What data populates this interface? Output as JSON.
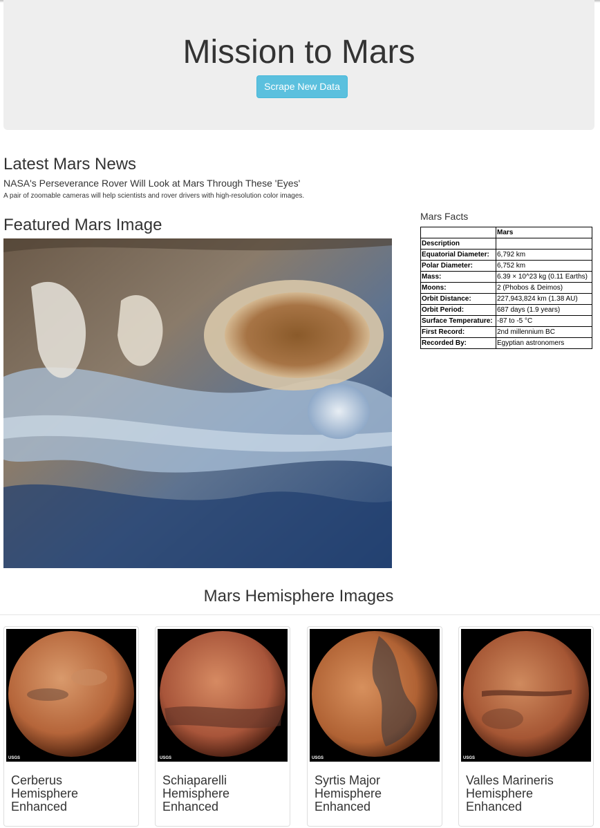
{
  "header": {
    "title": "Mission to Mars",
    "scrape_button": "Scrape New Data"
  },
  "news": {
    "heading": "Latest Mars News",
    "title": "NASA's Perseverance Rover Will Look at Mars Through These 'Eyes'",
    "teaser": "A pair of zoomable cameras will help scientists and rover drivers with high-resolution color images."
  },
  "featured": {
    "heading": "Featured Mars Image"
  },
  "facts": {
    "heading": "Mars Facts",
    "column_header": "Mars",
    "rows": [
      {
        "label": "Description",
        "value": ""
      },
      {
        "label": "Equatorial Diameter:",
        "value": "6,792 km"
      },
      {
        "label": "Polar Diameter:",
        "value": "6,752 km"
      },
      {
        "label": "Mass:",
        "value": "6.39 × 10^23 kg (0.11 Earths)"
      },
      {
        "label": "Moons:",
        "value": "2 (Phobos & Deimos)"
      },
      {
        "label": "Orbit Distance:",
        "value": "227,943,824 km (1.38 AU)"
      },
      {
        "label": "Orbit Period:",
        "value": "687 days (1.9 years)"
      },
      {
        "label": "Surface Temperature:",
        "value": "-87 to -5 °C"
      },
      {
        "label": "First Record:",
        "value": "2nd millennium BC"
      },
      {
        "label": "Recorded By:",
        "value": "Egyptian astronomers"
      }
    ]
  },
  "hemispheres": {
    "heading": "Mars Hemisphere Images",
    "items": [
      {
        "caption": "Cerberus Hemisphere Enhanced",
        "logo": "USGS"
      },
      {
        "caption": "Schiaparelli Hemisphere Enhanced",
        "logo": "USGS"
      },
      {
        "caption": "Syrtis Major Hemisphere Enhanced",
        "logo": "USGS"
      },
      {
        "caption": "Valles Marineris Hemisphere Enhanced",
        "logo": "USGS"
      }
    ]
  }
}
